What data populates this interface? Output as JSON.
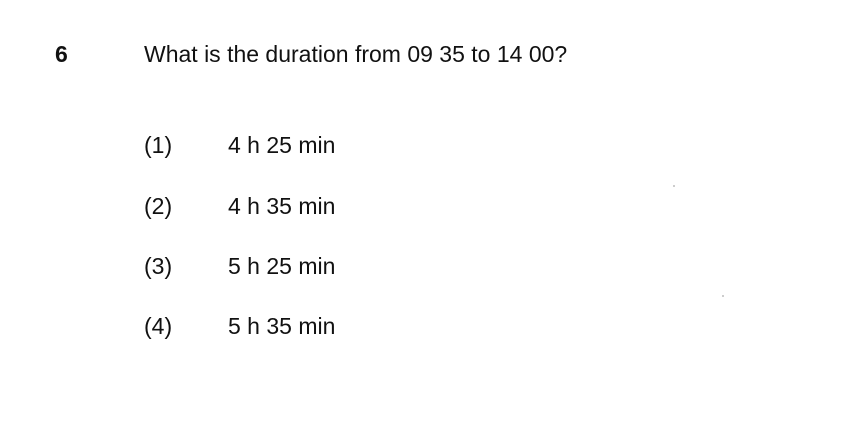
{
  "question": {
    "number": "6",
    "text": "What is the duration from 09 35 to 14 00?"
  },
  "options": [
    {
      "label": "(1)",
      "text": "4 h 25 min"
    },
    {
      "label": "(2)",
      "text": "4 h 35 min"
    },
    {
      "label": "(3)",
      "text": "5 h 25 min"
    },
    {
      "label": "(4)",
      "text": "5 h 35 min"
    }
  ]
}
